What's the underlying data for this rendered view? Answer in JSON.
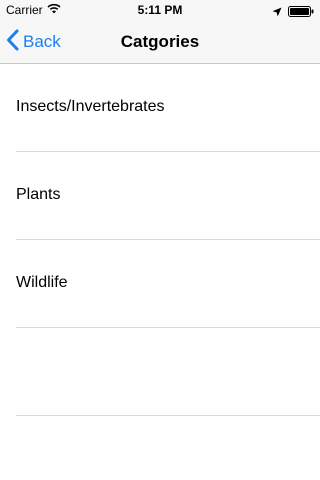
{
  "status_bar": {
    "carrier": "Carrier",
    "time": "5:11 PM",
    "battery_level": 1.0
  },
  "nav": {
    "back_label": "Back",
    "title": "Catgories"
  },
  "categories": [
    {
      "label": "Insects/Invertebrates"
    },
    {
      "label": "Plants"
    },
    {
      "label": "Wildlife"
    },
    {
      "label": ""
    }
  ],
  "colors": {
    "tint": "#1a7ff5",
    "bar_background": "#f7f7f8",
    "separator": "#d9d9dd"
  },
  "icons": [
    "wifi-icon",
    "location-arrow-icon",
    "battery-icon",
    "chevron-left-icon"
  ]
}
